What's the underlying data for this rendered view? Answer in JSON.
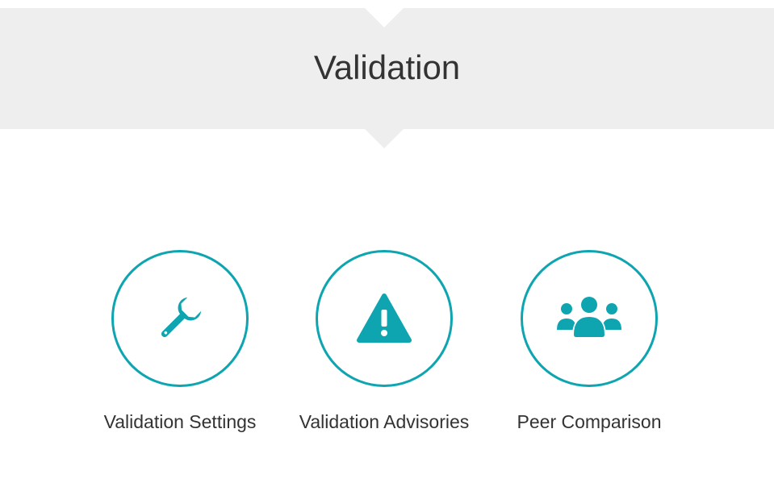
{
  "header": {
    "title": "Validation"
  },
  "colors": {
    "accent": "#0ea5b1",
    "banner_background": "#eeeeee",
    "text": "#333333"
  },
  "tiles": [
    {
      "label": "Validation Settings",
      "icon": "wrench-icon"
    },
    {
      "label": "Validation Advisories",
      "icon": "warning-icon"
    },
    {
      "label": "Peer Comparison",
      "icon": "users-icon"
    }
  ]
}
